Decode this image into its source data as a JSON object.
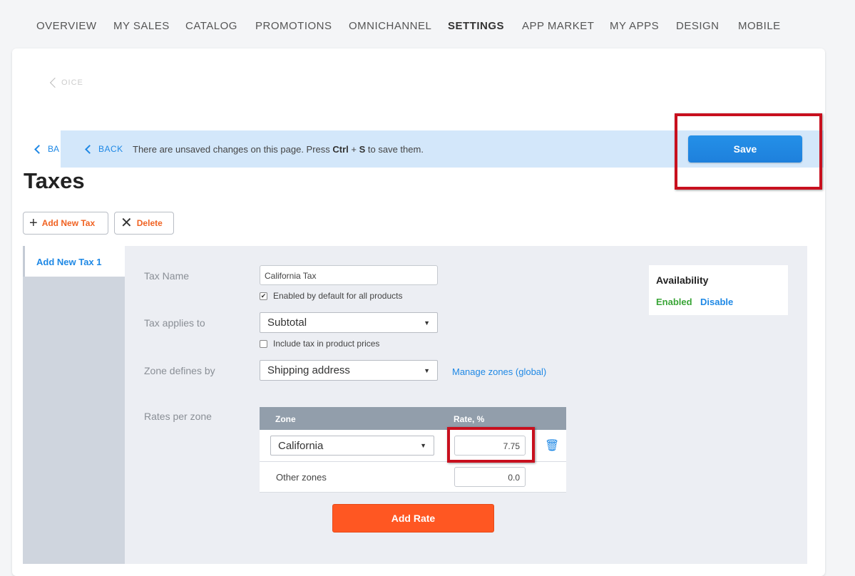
{
  "nav": {
    "items": [
      "OVERVIEW",
      "MY SALES",
      "CATALOG",
      "PROMOTIONS",
      "OMNICHANNEL",
      "SETTINGS",
      "APP MARKET",
      "MY APPS",
      "DESIGN",
      "MOBILE"
    ],
    "active": "SETTINGS"
  },
  "faded_back": "OICE",
  "back_under": "BA",
  "unsaved": {
    "back_label": "BACK",
    "msg_pre": "There are unsaved changes on this page. Press ",
    "key1": "Ctrl",
    "plus": " + ",
    "key2": "S",
    "msg_post": " to save them.",
    "save_label": "Save"
  },
  "page_title": "Taxes",
  "toolbar": {
    "add_label": "Add New Tax",
    "delete_label": "Delete"
  },
  "sidebar": {
    "selected_tax": "Add New Tax 1"
  },
  "form": {
    "tax_name_label": "Tax Name",
    "tax_name_value": "California Tax",
    "enabled_default_label": "Enabled by default for all products",
    "enabled_default_checked": true,
    "applies_label": "Tax applies to",
    "applies_value": "Subtotal",
    "include_tax_label": "Include tax in product prices",
    "include_tax_checked": false,
    "zone_label": "Zone defines by",
    "zone_value": "Shipping address",
    "manage_zones_link": "Manage zones (global)",
    "rates_label": "Rates per zone"
  },
  "availability": {
    "title": "Availability",
    "enabled": "Enabled",
    "disable": "Disable"
  },
  "rates_table": {
    "headers": [
      "Zone",
      "Rate, %"
    ],
    "rows": [
      {
        "zone": "California",
        "rate": "7.75"
      },
      {
        "zone": "Other zones",
        "rate": "0.0"
      }
    ],
    "add_rate_label": "Add Rate"
  },
  "colors": {
    "accent_blue": "#1e88e5",
    "accent_orange": "#ff5722",
    "highlight_red": "#c8101e",
    "enabled_green": "#3aa537"
  },
  "icons": {
    "back": "chevron-left-icon",
    "add": "plus-icon",
    "delete": "close-icon",
    "trash": "trash-icon",
    "dropdown": "caret-down-icon"
  }
}
